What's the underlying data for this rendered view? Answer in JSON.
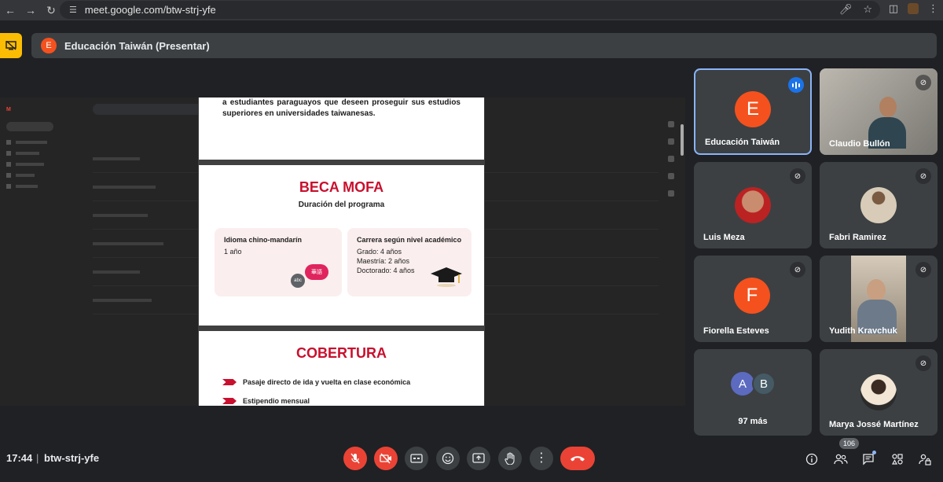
{
  "browser": {
    "url": "meet.google.com/btw-strj-yfe"
  },
  "presenting": {
    "avatar_letter": "E",
    "title": "Educación Taiwán (Presentar)"
  },
  "slides": {
    "intro_text": "a estudiantes paraguayos que deseen proseguir sus estudios superiores en universidades taiwanesas.",
    "beca_title": "BECA MOFA",
    "beca_subtitle": "Duración del programa",
    "card1_title": "Idioma chino-mandarín",
    "card1_line": "1 año",
    "card2_title": "Carrera según nivel académico",
    "card2_lines": [
      "Grado: 4 años",
      "Maestría: 2 años",
      "Doctorado: 4 años"
    ],
    "bubble_abc": "abc",
    "bubble_cn": "華語",
    "cobertura_title": "COBERTURA",
    "bullets": [
      "Pasaje directo de ida y vuelta en clase económica",
      "Estipendio mensual"
    ]
  },
  "participants": [
    {
      "name": "Educación Taiwán",
      "letter": "E",
      "color": "#f4511e"
    },
    {
      "name": "Claudio Bullón"
    },
    {
      "name": "Luis Meza"
    },
    {
      "name": "Fabri Ramirez"
    },
    {
      "name": "Fiorella Esteves",
      "letter": "F",
      "color": "#f4511e"
    },
    {
      "name": "Yudith Kravchuk"
    },
    {
      "name": "97 más",
      "letters": [
        "A",
        "B"
      ]
    },
    {
      "name": "Marya Jossé Martínez"
    }
  ],
  "bottom": {
    "time": "17:44",
    "meeting_code": "btw-strj-yfe",
    "people_count": "106"
  },
  "icons": {
    "mic": "mic-off-icon",
    "camera": "camera-off-icon",
    "captions": "captions-icon",
    "emoji": "emoji-icon",
    "present": "present-icon",
    "hand": "raise-hand-icon",
    "more": "more-icon",
    "end": "end-call-icon"
  }
}
